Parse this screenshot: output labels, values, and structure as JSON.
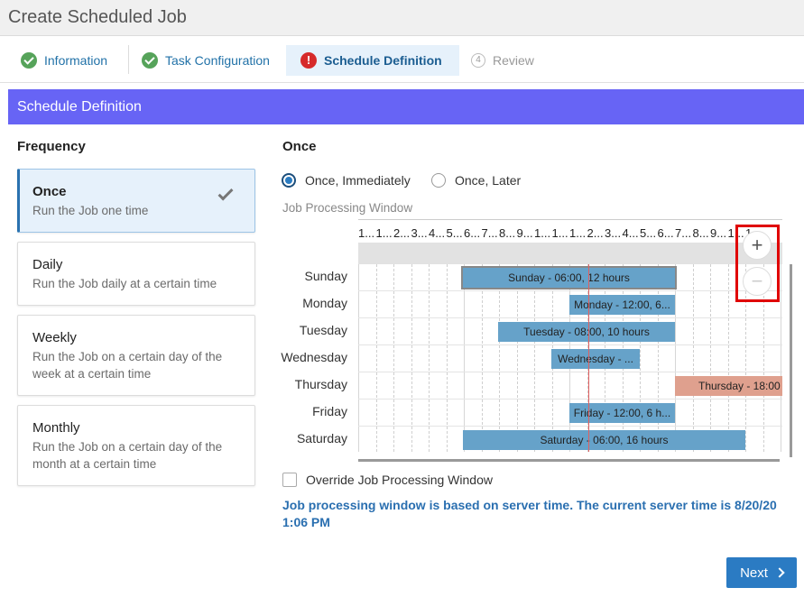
{
  "window": {
    "title": "Create Scheduled Job"
  },
  "steps": [
    {
      "label": "Information",
      "state": "done"
    },
    {
      "label": "Task Configuration",
      "state": "done"
    },
    {
      "label": "Schedule Definition",
      "state": "active"
    },
    {
      "number": "4",
      "label": "Review",
      "state": "future"
    }
  ],
  "section": {
    "title": "Schedule Definition"
  },
  "frequency": {
    "title": "Frequency",
    "options": [
      {
        "title": "Once",
        "desc": "Run the Job one time",
        "selected": true
      },
      {
        "title": "Daily",
        "desc": "Run the Job daily at a certain time",
        "selected": false
      },
      {
        "title": "Weekly",
        "desc": "Run the Job on a certain day of the week at a certain time",
        "selected": false
      },
      {
        "title": "Monthly",
        "desc": "Run the Job on a certain day of the month at a certain time",
        "selected": false
      }
    ]
  },
  "once": {
    "title": "Once",
    "radio_immediately": "Once, Immediately",
    "radio_later": "Once, Later",
    "selected": "immediately"
  },
  "window_chart": {
    "label": "Job Processing Window",
    "axis_labels": [
      "1...",
      "1...",
      "2...",
      "3...",
      "4...",
      "5...",
      "6...",
      "7...",
      "8...",
      "9...",
      "1...",
      "1...",
      "1...",
      "2...",
      "3...",
      "4...",
      "5...",
      "6...",
      "7...",
      "8...",
      "9...",
      "1...",
      "1..."
    ],
    "days": [
      "Sunday",
      "Monday",
      "Tuesday",
      "Wednesday",
      "Thursday",
      "Friday",
      "Saturday"
    ],
    "bars": [
      {
        "label": "Sunday - 06:00, 12 hours",
        "selected": true
      },
      {
        "label": "Monday - 12:00, 6..."
      },
      {
        "label": "Tuesday - 08:00, 10 hours"
      },
      {
        "label": "Wednesday - ..."
      },
      {
        "label": "Thursday - 18:00"
      },
      {
        "label": "Friday - 12:00, 6 h..."
      },
      {
        "label": "Saturday - 06:00, 16 hours"
      }
    ],
    "zoom_in": "+",
    "zoom_out": "−"
  },
  "override": {
    "label": "Override Job Processing Window",
    "checked": false
  },
  "note": "Job processing window is based on server time. The current server time is 8/20/20 1:06 PM",
  "footer": {
    "next_label": "Next"
  },
  "colors": {
    "accent": "#6764f5",
    "bar": "#66a2c9",
    "bar_alt": "#dfa08e",
    "primary_button": "#2b7bc3"
  }
}
